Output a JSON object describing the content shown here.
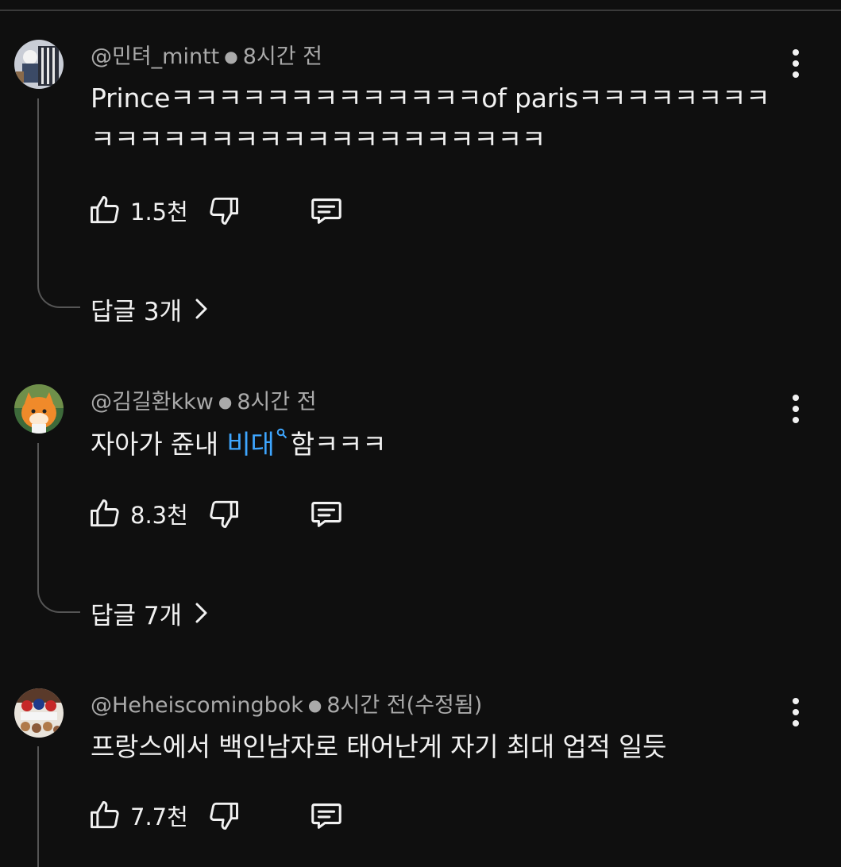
{
  "comments": [
    {
      "author": "@민텨_mintt",
      "time": "8시간 전",
      "text": "Princeㅋㅋㅋㅋㅋㅋㅋㅋㅋㅋㅋㅋㅋof parisㅋㅋㅋㅋㅋㅋㅋㅋㅋㅋㅋㅋㅋㅋㅋㅋㅋㅋㅋㅋㅋㅋㅋㅋㅋㅋㅋ",
      "likes": "1.5천",
      "replies": "답글 3개"
    },
    {
      "author": "@김길환kkw",
      "time": "8시간 전",
      "text_before": "자아가 쥰내 ",
      "text_link": "비대",
      "text_after": "함ㅋㅋㅋ",
      "likes": "8.3천",
      "replies": "답글 7개"
    },
    {
      "author": "@Heheiscomingbok",
      "time": "8시간 전(수정됨)",
      "text": "프랑스에서 백인남자로 태어난게 자기 최대 업적 일듯",
      "likes": "7.7천"
    }
  ],
  "icons": {
    "like": "thumbs-up-icon",
    "dislike": "thumbs-down-icon",
    "reply": "comment-icon",
    "more": "more-vert-icon",
    "replies_chevron": "chevron-right-icon",
    "search_term": "search-icon"
  },
  "colors": {
    "background": "#0f0f0f",
    "text": "#f1f1f1",
    "secondary_text": "#aaaaaa",
    "link": "#3ea6ff"
  }
}
